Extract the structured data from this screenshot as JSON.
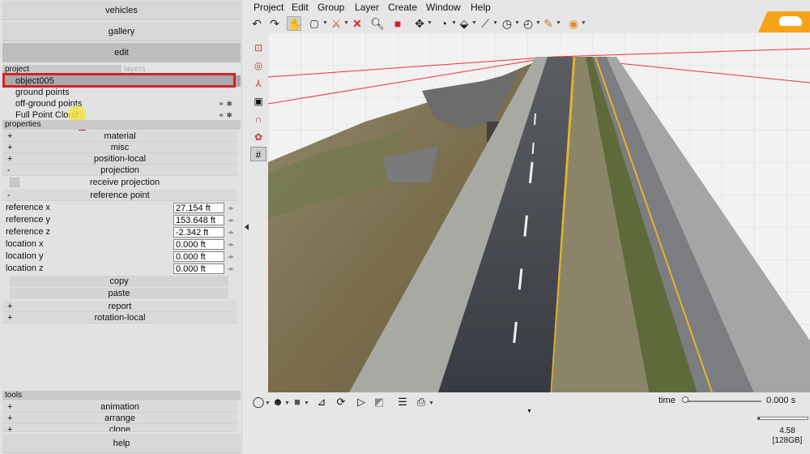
{
  "left_panel": {
    "vehicles_label": "vehicles",
    "gallery_label": "gallery",
    "edit_label": "edit",
    "tabs": {
      "project": "project",
      "layers": "layers"
    },
    "tree": [
      "object005",
      "ground points",
      "off-ground points",
      "Full Point Cloud"
    ],
    "properties_header": "properties",
    "sections": {
      "material": "material",
      "misc": "misc",
      "position_local": "position-local",
      "projection": "projection",
      "receive_projection": "receive projection",
      "reference_point": "reference point",
      "report": "report",
      "rotation_local": "rotation-local"
    },
    "expanders": {
      "plus": "+",
      "minus": "-"
    },
    "fields": [
      {
        "label": "reference x",
        "value": "27.154 ft"
      },
      {
        "label": "reference y",
        "value": "153.648 ft"
      },
      {
        "label": "reference z",
        "value": "-2.342 ft"
      },
      {
        "label": "location x",
        "value": "0.000 ft"
      },
      {
        "label": "location y",
        "value": "0.000 ft"
      },
      {
        "label": "location z",
        "value": "0.000 ft"
      }
    ],
    "copy_label": "copy",
    "paste_label": "paste",
    "tools_header": "tools",
    "tools": {
      "animation": "animation",
      "arrange": "arrange",
      "clone": "clone"
    },
    "help_label": "help"
  },
  "menu": [
    "Project",
    "Edit",
    "Group",
    "Layer",
    "Create",
    "Window",
    "Help"
  ],
  "toolbar_icons": [
    "undo-icon",
    "redo-icon",
    "pan-hand-icon",
    "select-box-icon",
    "transform-icon",
    "delete-icon",
    "zoom-icon",
    "red-cube-icon",
    "move-icon",
    "measure-icon",
    "ruler-icon",
    "angle-icon",
    "orbit-icon",
    "clock-icon",
    "pencil-icon",
    "help-icon"
  ],
  "timeline": {
    "time_label": "time",
    "time_value": "0.000 s",
    "time_fraction": 0.0,
    "memory_line1": "4.58",
    "memory_line2": "[128GB]",
    "memory_fraction": 0.04
  },
  "colors": {
    "selection_outline": "#d4202a",
    "accent_orange": "#f5a21b",
    "road_asphalt": "#3d4146",
    "lane_yellow": "#e3b42c"
  }
}
